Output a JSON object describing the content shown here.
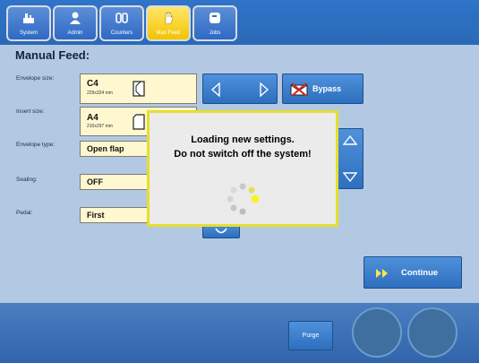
{
  "tabs": [
    {
      "label": "System",
      "icon": "system-icon"
    },
    {
      "label": "Admin",
      "icon": "admin-icon"
    },
    {
      "label": "Counters",
      "icon": "counters-icon"
    },
    {
      "label": "Man Feed",
      "icon": "hand-icon",
      "active": true
    },
    {
      "label": "Jobs",
      "icon": "jobs-icon"
    }
  ],
  "page": {
    "title": "Manual Feed:"
  },
  "rows": {
    "envelope_size": {
      "label": "Envelope size:",
      "value": "C4",
      "sub": "229x324 mm"
    },
    "insert_size": {
      "label": "Insert size:",
      "value": "A4",
      "sub": "210x297 mm"
    },
    "envelope_type": {
      "label": "Envelope type:",
      "value": "Open flap"
    },
    "sealing": {
      "label": "Sealing:",
      "value": "OFF"
    },
    "pedal": {
      "label": "Pedal:",
      "value": "First"
    }
  },
  "buttons": {
    "bypass": "Bypass",
    "continue": "Continue",
    "purge": "Purge"
  },
  "dialog": {
    "line1": "Loading new settings.",
    "line2": "Do not switch off the system!"
  },
  "colors": {
    "accent_yellow": "#f3c300",
    "button_blue": "#2e6fbe",
    "background": "#b3c9e3"
  }
}
